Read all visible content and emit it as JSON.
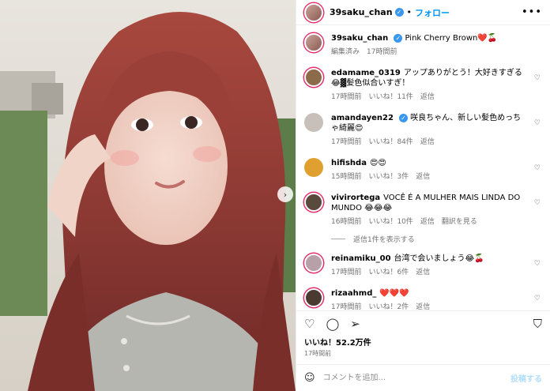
{
  "header": {
    "username": "39saku_chan",
    "follow": "フォロー"
  },
  "caption": {
    "username": "39saku_chan",
    "text": "Pink Cherry Brown❤️🍒",
    "meta_edited": "編集済み",
    "meta_time": "17時間前"
  },
  "comments": [
    {
      "username": "edamame_0319",
      "text": "アップありがとう！大好きすぎる😂▓髪色似合いすぎ！",
      "time": "17時間前",
      "likes": "いいね！11件",
      "reply": "返信",
      "color": "#8b6b4a"
    },
    {
      "username": "amandayen22",
      "verified": true,
      "text": "咲良ちゃん、新しい髪色めっちゃ綺麗😍",
      "time": "17時間前",
      "likes": "いいね！84件",
      "reply": "返信",
      "color": "#c8c0b8"
    },
    {
      "username": "hifishda",
      "text": "😍😍",
      "time": "15時間前",
      "likes": "いいね！3件",
      "reply": "返信",
      "color": "#e0a030"
    },
    {
      "username": "vivirortega",
      "text": "VOCÊ É A MULHER MAIS LINDA DO MUNDO 😂😂😂",
      "time": "16時間前",
      "likes": "いいね！10件",
      "reply": "返信",
      "extra": "翻訳を見る",
      "color": "#5a4a3e"
    },
    {
      "username": "reinamiku_00",
      "text": "台湾で会いましょう😂🍒",
      "time": "17時間前",
      "likes": "いいね！6件",
      "reply": "返信",
      "color": "#b8a0a8"
    },
    {
      "username": "rizaahmd_",
      "text": "❤️❤️❤️",
      "time": "17時間前",
      "likes": "いいね！2件",
      "reply": "返信",
      "color": "#4a3a30"
    }
  ],
  "view_replies": "返信1件を表示する",
  "likes_total": "いいね！52.2万件",
  "post_time": "17時間前",
  "add_comment": {
    "placeholder": "コメントを追加...",
    "post": "投稿する"
  },
  "colors": {
    "accent": "#0095f6",
    "verified": "#3897f0",
    "ring": "#e1306c"
  },
  "icons": [
    "heart-icon",
    "comment-icon",
    "share-icon",
    "bookmark-icon",
    "emoji-icon",
    "more-icon",
    "verified-icon",
    "chevron-right-icon"
  ]
}
